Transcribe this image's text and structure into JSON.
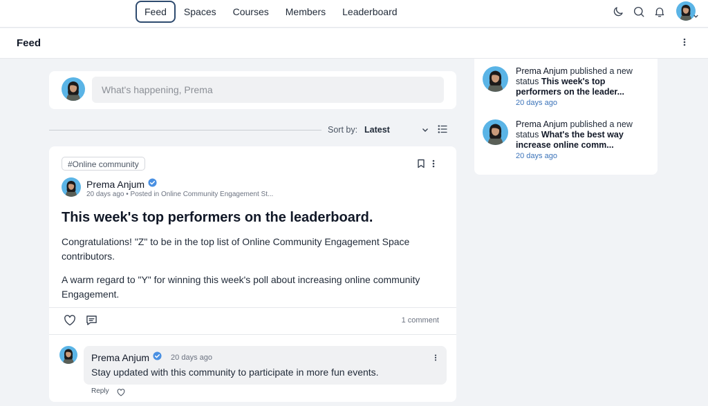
{
  "nav": {
    "items": [
      {
        "label": "Feed",
        "active": true
      },
      {
        "label": "Spaces",
        "active": false
      },
      {
        "label": "Courses",
        "active": false
      },
      {
        "label": "Members",
        "active": false
      },
      {
        "label": "Leaderboard",
        "active": false
      }
    ],
    "icons": [
      "moon-icon",
      "search-icon",
      "bell-icon"
    ]
  },
  "header": {
    "title": "Feed"
  },
  "composer": {
    "placeholder": "What's happening, Prema"
  },
  "sort": {
    "label": "Sort by:",
    "value": "Latest"
  },
  "post": {
    "tag": "#Online community",
    "author": "Prema Anjum",
    "verified": true,
    "meta": "20 days ago • Posted in Online Community Engagement St...",
    "title": "This week's top performers on the leaderboard.",
    "paragraphs": [
      "Congratulations! \"Z\" to be in the top list of Online Community Engagement Space contributors.",
      "A warm regard to \"Y\" for winning this week's poll about increasing online community Engagement."
    ],
    "comment_count": "1 comment"
  },
  "comment": {
    "author": "Prema Anjum",
    "time": "20 days ago",
    "text": "Stay updated with this community to participate in more fun events.",
    "reply_label": "Reply"
  },
  "activity": [
    {
      "name": "Prema Anjum",
      "verb": " published a new status ",
      "title": "This week's top performers on the leader...",
      "time": "20 days ago"
    },
    {
      "name": "Prema Anjum",
      "verb": " published a new status ",
      "title": "What's the best way increase online comm...",
      "time": "20 days ago"
    }
  ],
  "colors": {
    "accent": "#2d4a6e",
    "verified": "#4a90e2",
    "link": "#3b73b9",
    "background": "#f1f3f6"
  }
}
